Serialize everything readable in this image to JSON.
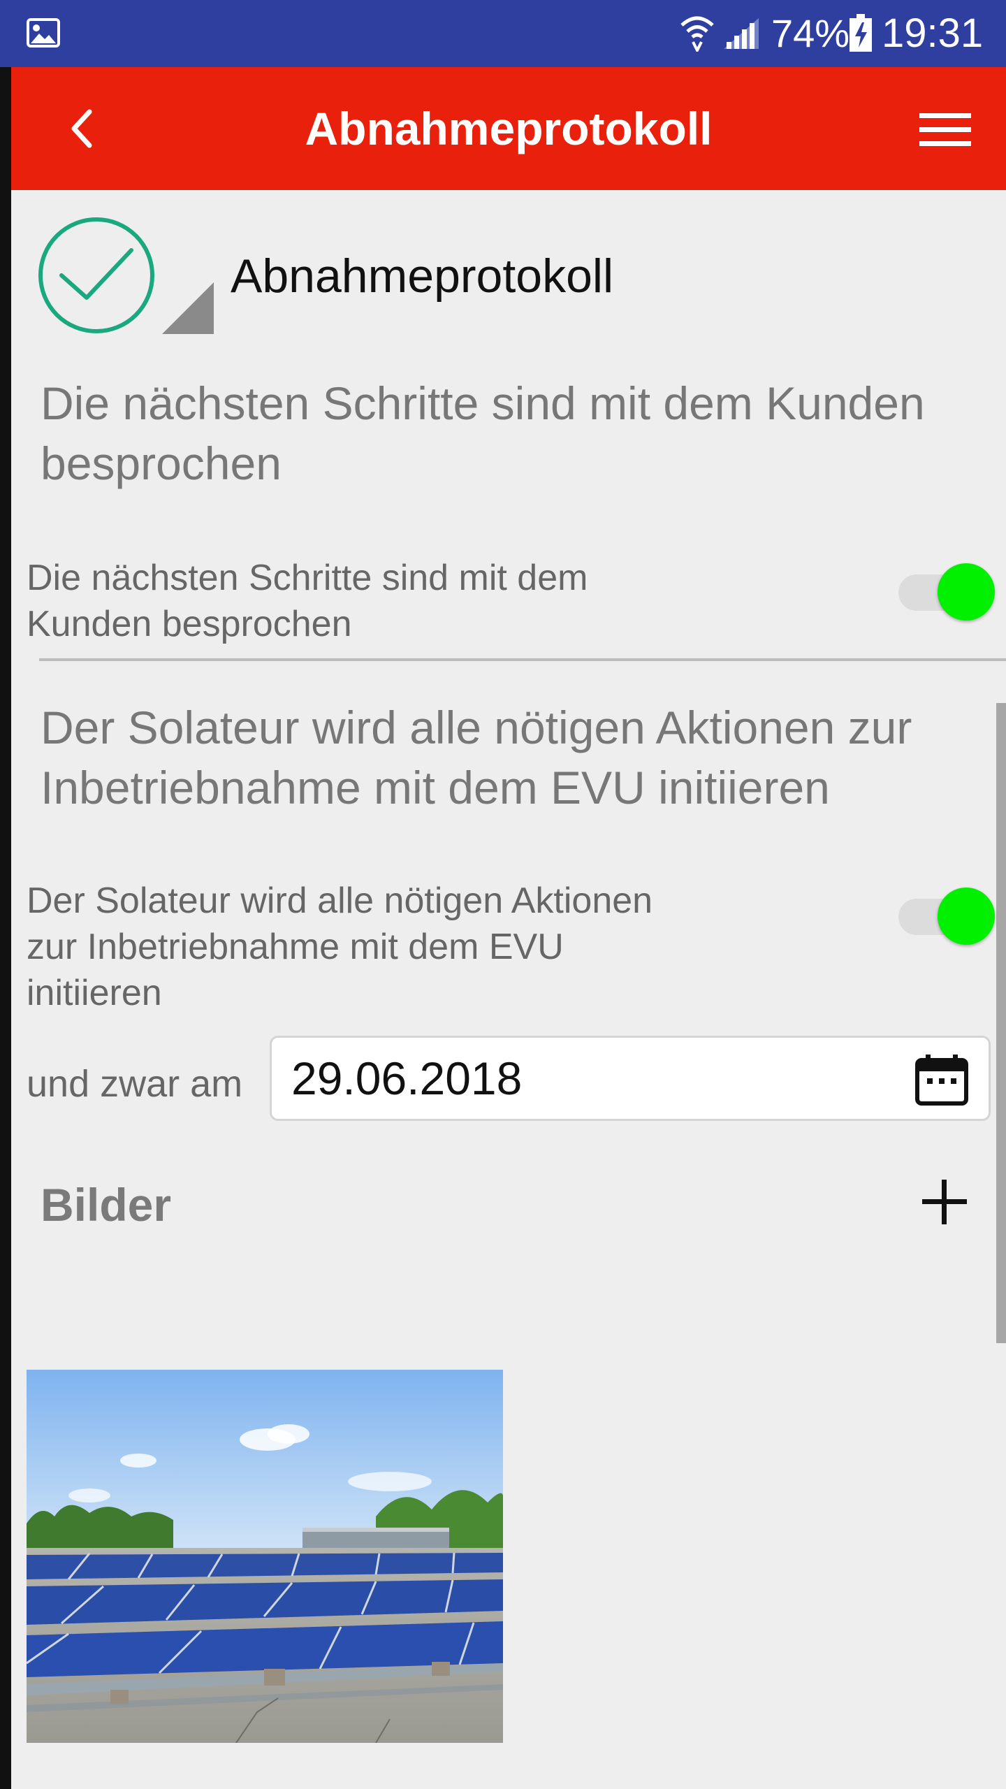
{
  "status_bar": {
    "battery_percent": "74%",
    "time": "19:31",
    "icons": [
      "gallery-icon",
      "wifi-icon",
      "signal-icon",
      "battery-charging-icon"
    ]
  },
  "app_bar": {
    "title": "Abnahmeprotokoll",
    "back_icon": "chevron-left-icon",
    "menu_icon": "hamburger-menu-icon",
    "color": "#e8200c"
  },
  "section": {
    "title": "Abnahmeprotokoll",
    "status_icon": "check-circle-icon"
  },
  "items": [
    {
      "question": "Die nächsten Schritte sind mit dem Kunden besprochen",
      "label": "Die nächsten Schritte sind mit dem Kunden besprochen",
      "toggle_on": true
    },
    {
      "question": "Der Solateur wird alle nötigen Aktionen zur Inbetriebnahme mit dem EVU initiieren",
      "label": "Der Solateur wird alle nötigen Aktionen zur Inbetriebnahme mit dem EVU initiieren",
      "toggle_on": true
    }
  ],
  "date_row": {
    "label": "und zwar am",
    "value": "29.06.2018",
    "icon": "calendar-icon"
  },
  "images_section": {
    "title": "Bilder",
    "add_icon": "plus-icon",
    "photos": [
      {
        "description_icon": "solar-panel-photo"
      }
    ]
  },
  "colors": {
    "status_bar": "#2f3fa0",
    "toggle_on": "#00f000",
    "check_green": "#1aa97e"
  }
}
